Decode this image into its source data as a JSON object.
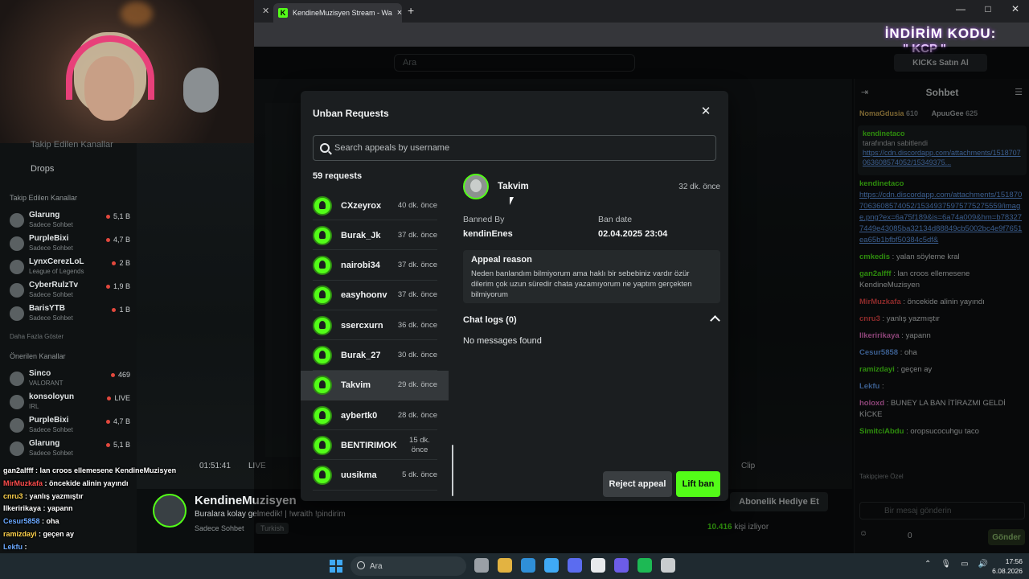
{
  "browser": {
    "tab_title": "KendineMuzisyen Stream - Wa",
    "tab_close": "×",
    "new_tab": "+",
    "window_controls": [
      "—",
      "□",
      "✕"
    ]
  },
  "kick": {
    "search_placeholder": "Ara",
    "buy_kicks": "KICKs Satın Al",
    "promo_line1": "İNDİRİM KODU:",
    "promo_line2": "\" KCP \""
  },
  "sidebar": {
    "following_header": "Takip Edilen Kanallar",
    "drops": "Drops",
    "section_following": "Takip Edilen Kanallar",
    "following": [
      {
        "name": "Glarung",
        "game": "Sadece Sohbet",
        "count": "5,1 B"
      },
      {
        "name": "PurpleBixi",
        "game": "Sadece Sohbet",
        "count": "4,7 B"
      },
      {
        "name": "LynxCerezLoL",
        "game": "League of Legends",
        "count": "2 B"
      },
      {
        "name": "CyberRulzTv",
        "game": "Sadece Sohbet",
        "count": "1,9 B"
      },
      {
        "name": "BarisYTB",
        "game": "Sadece Sohbet",
        "count": "1 B"
      }
    ],
    "show_more": "Daha Fazla Göster",
    "section_recommended": "Önerilen Kanallar",
    "recommended": [
      {
        "name": "Sinco",
        "game": "VALORANT",
        "count": "469"
      },
      {
        "name": "konsoloyun",
        "game": "IRL",
        "count": "LIVE"
      },
      {
        "name": "PurpleBixi",
        "game": "Sadece Sohbet",
        "count": "4,7 B"
      },
      {
        "name": "Glarung",
        "game": "Sadece Sohbet",
        "count": "5,1 B"
      }
    ]
  },
  "overlay_chat": [
    {
      "user": "gan2alfff",
      "text": " : lan croos ellemesene KendineMuzisyen"
    },
    {
      "user": "MirMuzkafa",
      "text": " : öncekide alinin yayındı"
    },
    {
      "user": "cnru3",
      "text": " : yanlış yazmıştır"
    },
    {
      "user": "Ilkeririkaya",
      "text": " : yapann"
    },
    {
      "user": "Cesur5858",
      "text": " : oha"
    },
    {
      "user": "ramizdayi",
      "text": " : geçen ay"
    },
    {
      "user": "Lekfu",
      "text": " :"
    },
    {
      "user": "holoxd",
      "text": " : BUNEY LA BAN İTİRAZMI GELDİ KİCKE"
    },
    {
      "user": "SimitciAbdu",
      "text": " : oropsucocuhgu taco"
    }
  ],
  "stream": {
    "time": "01:51:41",
    "live": "LIVE",
    "clip": "Clip",
    "streamer": "KendineMuzisyen",
    "title": "Buralara kolay gelmedik! | !wraith !pindirim",
    "category": "Sadece Sohbet",
    "language": "Turkish",
    "subscribe_gift": "Abonelik Hediye Et",
    "viewers_count": "10.416",
    "viewers_label": "kişi izliyor"
  },
  "chat": {
    "title": "Sohbet",
    "gifter1": "NomaGdusia",
    "gifter1_count": "610",
    "gifter2": "ApuuGee",
    "gifter2_count": "625",
    "pinned_by": "kendinetaco",
    "pinned_note": "tarafından sabitlendi",
    "pinned_link": "https://cdn.discordapp.com/attachments/1518707063608574052/15349375...",
    "messages": [
      {
        "user": "kendinetaco",
        "color": "#53fc18",
        "text": "",
        "link": "https://cdn.discordapp.com/attachments/1518707063608574052/15349375975775275559/image.png?ex=6a75f189&is=6a74a009&hm=b783277449e43085ba32134d88849cb5002bc4e9f7651ea65b1bfbf50384c5df&"
      },
      {
        "user": "cmkedis",
        "color": "#53fc18",
        "text": ": yalan söyleme kral"
      },
      {
        "user": "gan2alfff",
        "color": "#53fc18",
        "text": ": lan croos ellemesene KendineMuzisyen"
      },
      {
        "user": "MirMuzkafa",
        "color": "#ff4d4d",
        "text": ": öncekide alinin yayındı"
      },
      {
        "user": "cnru3",
        "color": "#ff4d4d",
        "text": ": yanlış yazmıştır"
      },
      {
        "user": "Ilkeririkaya",
        "color": "#ff7ad9",
        "text": ": yapann"
      },
      {
        "user": "Cesur5858",
        "color": "#6aa8ff",
        "text": ": oha"
      },
      {
        "user": "ramizdayi",
        "color": "#53fc18",
        "text": ": geçen ay"
      },
      {
        "user": "Lekfu",
        "color": "#6aa8ff",
        "text": ":"
      },
      {
        "user": "holoxd",
        "color": "#ff7ad9",
        "text": ": BUNEY LA BAN İTİRAZMI GELDİ KİCKE"
      },
      {
        "user": "SimitciAbdu",
        "color": "#53fc18",
        "text": ": oropsucocuhgu taco"
      }
    ],
    "top_gifters": "Takipçiere Özel",
    "input_placeholder": "Bir mesaj gönderin",
    "points": "0",
    "send": "Gönder"
  },
  "modal": {
    "title": "Unban Requests",
    "close": "✕",
    "search_placeholder": "Search appeals by username",
    "count": "59 requests",
    "requests": [
      {
        "name": "CXzeyrox",
        "time": "40 dk. önce"
      },
      {
        "name": "Burak_Jk",
        "time": "37 dk. önce"
      },
      {
        "name": "nairobi34",
        "time": "37 dk. önce"
      },
      {
        "name": "easyhoonv",
        "time": "37 dk. önce"
      },
      {
        "name": "ssercxurn",
        "time": "36 dk. önce"
      },
      {
        "name": "Burak_27",
        "time": "30 dk. önce"
      },
      {
        "name": "Takvim",
        "time": "29 dk. önce"
      },
      {
        "name": "aybertk0",
        "time": "28 dk. önce"
      },
      {
        "name": "BENTIRIMOK",
        "time": "15 dk.\nönce"
      },
      {
        "name": "uusikma",
        "time": "5 dk. önce"
      }
    ],
    "selected_index": 6,
    "detail": {
      "username": "Takvim",
      "time": "32 dk. önce",
      "banned_by_label": "Banned By",
      "banned_by": "kendinEnes",
      "ban_date_label": "Ban date",
      "ban_date": "02.04.2025 23:04",
      "appeal_title": "Appeal reason",
      "appeal_text": "Neden banlandım bilmiyorum ama haklı bir sebebiniz vardır özür dilerim çok uzun süredir chata yazamıyorum ne yaptım gerçekten bilmiyorum",
      "chat_logs": "Chat logs (0)",
      "no_messages": "No messages found"
    },
    "reject": "Reject appeal",
    "lift": "Lift ban"
  },
  "taskbar": {
    "search": "Ara",
    "time": "17:56",
    "date": "6.08.2026",
    "icon_colors": [
      "#9aa0a6",
      "#e3b341",
      "#2f8fd8",
      "#3fa9f5",
      "#5b6cf0",
      "#e8eaed",
      "#6c5ce7",
      "#1db954",
      "#c9cdcf"
    ]
  },
  "colors": {
    "accent": "#53fc18",
    "modal_bg": "#1b1e20",
    "selected_row": "#34383b"
  }
}
